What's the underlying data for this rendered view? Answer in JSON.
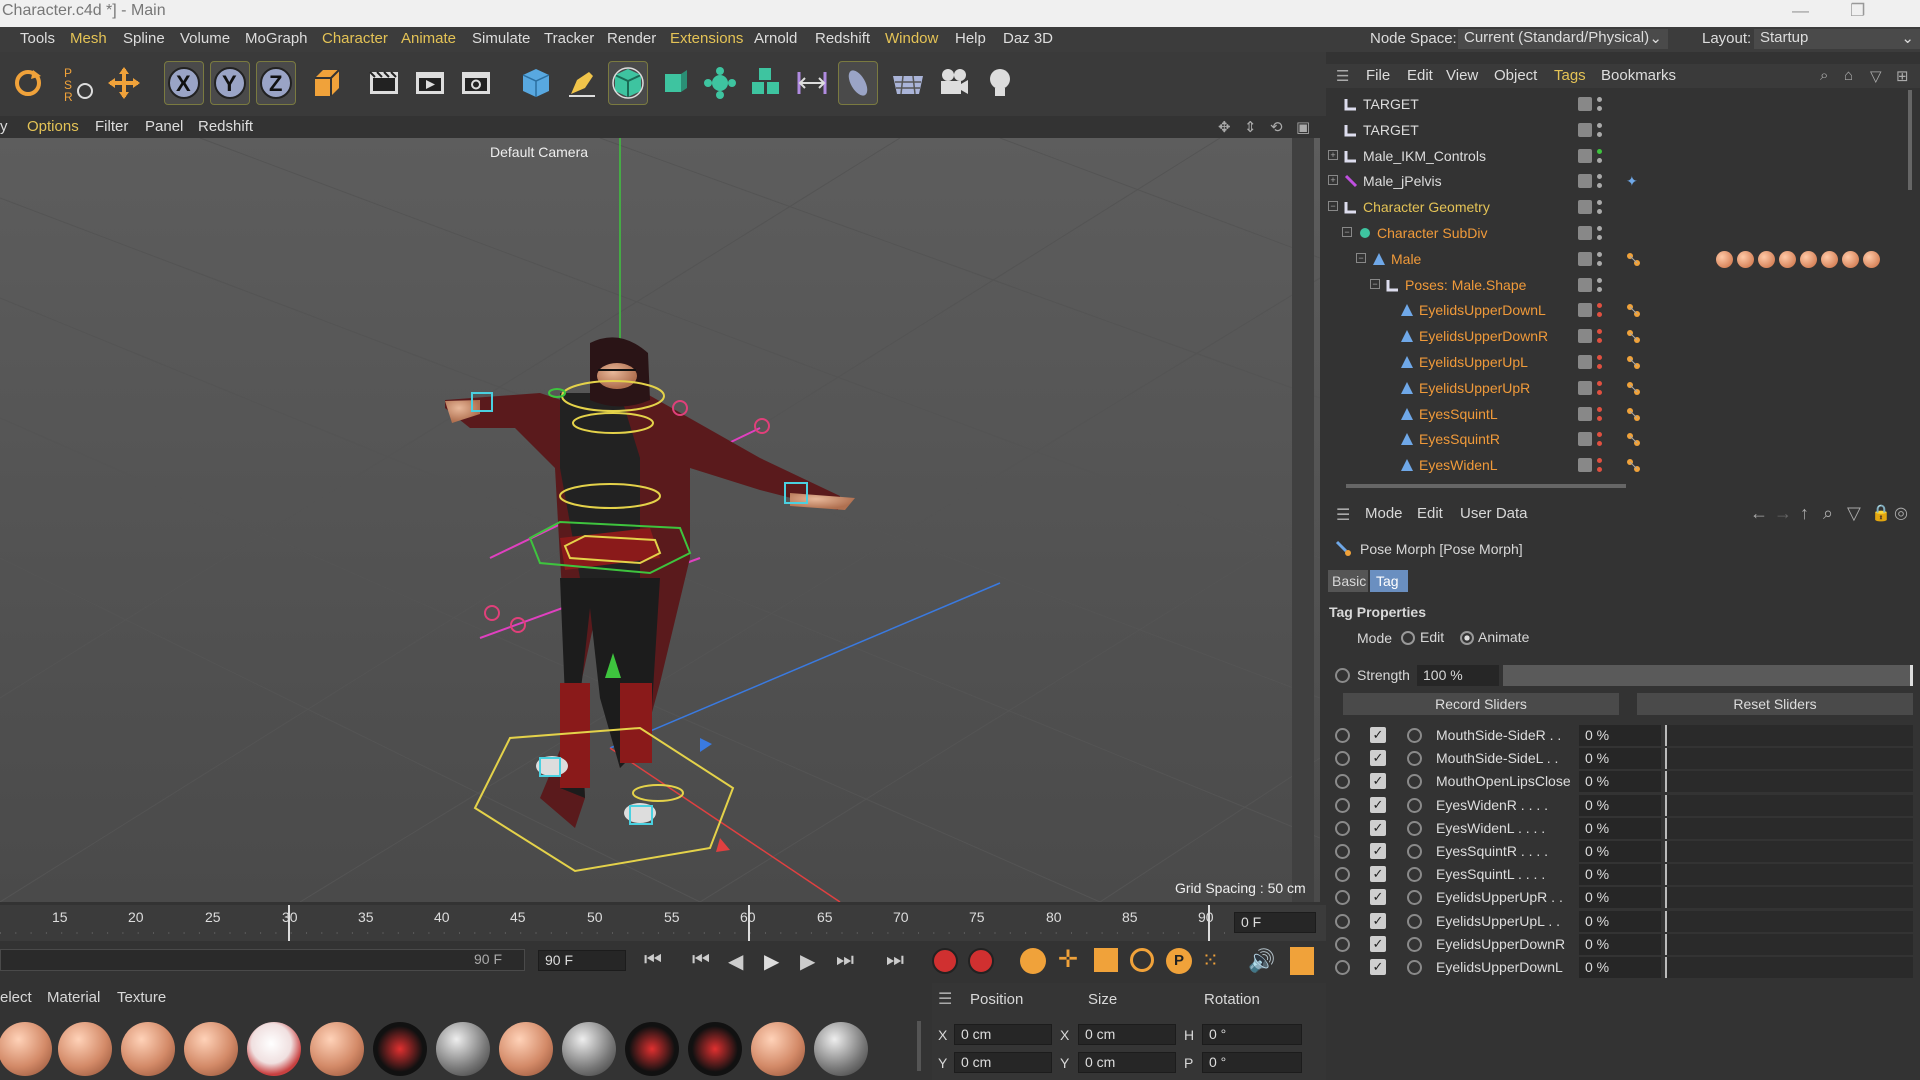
{
  "titlebar": {
    "title": "Character.c4d *] - Main"
  },
  "menu": {
    "items": [
      "Tools",
      "Mesh",
      "Spline",
      "Volume",
      "MoGraph",
      "Character",
      "Animate",
      "Simulate",
      "Tracker",
      "Render",
      "Extensions",
      "Arnold",
      "Redshift",
      "Window",
      "Help",
      "Daz 3D"
    ],
    "node_space_label": "Node Space:",
    "node_space_value": "Current (Standard/Physical)",
    "layout_label": "Layout:",
    "layout_value": "Startup"
  },
  "viewport_menu": {
    "items": [
      "y",
      "Options",
      "Filter",
      "Panel",
      "Redshift"
    ]
  },
  "viewport": {
    "camera_label": "Default Camera",
    "grid_spacing": "Grid Spacing : 50 cm"
  },
  "timeline": {
    "ticks": [
      "15",
      "20",
      "25",
      "30",
      "35",
      "40",
      "45",
      "50",
      "55",
      "60",
      "65",
      "70",
      "75",
      "80",
      "85",
      "90"
    ],
    "current_frame": "0 F",
    "end_field_a": "90 F",
    "end_field_b": "90 F"
  },
  "material_menu": {
    "items": [
      "elect",
      "Material",
      "Texture"
    ]
  },
  "coords": {
    "headers": [
      "Position",
      "Size",
      "Rotation"
    ],
    "rows": [
      {
        "a": "X",
        "pos": "0 cm",
        "b": "X",
        "size": "0 cm",
        "c": "H",
        "rot": "0 °"
      },
      {
        "a": "Y",
        "pos": "0 cm",
        "b": "Y",
        "size": "0 cm",
        "c": "P",
        "rot": "0 °"
      }
    ]
  },
  "object_manager": {
    "menu": [
      "File",
      "Edit",
      "View",
      "Object",
      "Tags",
      "Bookmarks"
    ],
    "rows": [
      {
        "name": "TARGET",
        "style": "w",
        "indent": 0
      },
      {
        "name": "TARGET",
        "style": "w",
        "indent": 0
      },
      {
        "name": "Male_IKM_Controls",
        "style": "w",
        "indent": 0
      },
      {
        "name": "Male_jPelvis",
        "style": "w",
        "indent": 0
      },
      {
        "name": "Character Geometry",
        "style": "y",
        "indent": 0
      },
      {
        "name": "Character SubDiv",
        "style": "o",
        "indent": 1
      },
      {
        "name": "Male",
        "style": "o",
        "indent": 2
      },
      {
        "name": "Poses: Male.Shape",
        "style": "o",
        "indent": 3
      },
      {
        "name": "EyelidsUpperDownL",
        "style": "o",
        "indent": 4
      },
      {
        "name": "EyelidsUpperDownR",
        "style": "o",
        "indent": 4
      },
      {
        "name": "EyelidsUpperUpL",
        "style": "o",
        "indent": 4
      },
      {
        "name": "EyelidsUpperUpR",
        "style": "o",
        "indent": 4
      },
      {
        "name": "EyesSquintL",
        "style": "o",
        "indent": 4
      },
      {
        "name": "EyesSquintR",
        "style": "o",
        "indent": 4
      },
      {
        "name": "EyesWidenL",
        "style": "o",
        "indent": 4
      }
    ]
  },
  "attributes": {
    "menu": [
      "Mode",
      "Edit",
      "User Data"
    ],
    "object_title": "Pose Morph [Pose Morph]",
    "tabs": [
      "Basic",
      "Tag"
    ],
    "section": "Tag Properties",
    "mode_label": "Mode",
    "mode_edit": "Edit",
    "mode_animate": "Animate",
    "strength_label": "Strength",
    "strength_value": "100 %",
    "record_button": "Record Sliders",
    "reset_button": "Reset Sliders",
    "sliders": [
      {
        "name": "MouthSide-SideR . .",
        "value": "0 %"
      },
      {
        "name": "MouthSide-SideL . .",
        "value": "0 %"
      },
      {
        "name": "MouthOpenLipsClose",
        "value": "0 %"
      },
      {
        "name": "EyesWidenR . . . .",
        "value": "0 %"
      },
      {
        "name": "EyesWidenL . . . .",
        "value": "0 %"
      },
      {
        "name": "EyesSquintR . . . .",
        "value": "0 %"
      },
      {
        "name": "EyesSquintL . . . .",
        "value": "0 %"
      },
      {
        "name": "EyelidsUpperUpR . .",
        "value": "0 %"
      },
      {
        "name": "EyelidsUpperUpL . .",
        "value": "0 %"
      },
      {
        "name": "EyelidsUpperDownR",
        "value": "0 %"
      },
      {
        "name": "EyelidsUpperDownL",
        "value": "0 %"
      }
    ]
  }
}
